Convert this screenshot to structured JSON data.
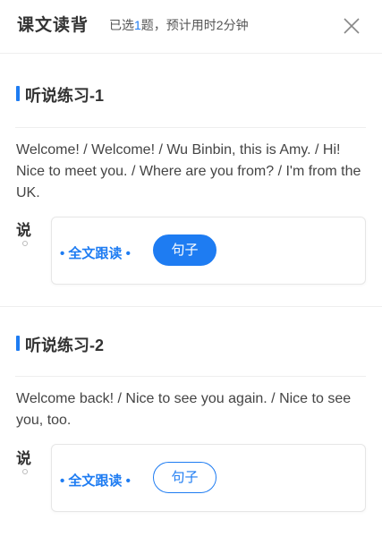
{
  "header": {
    "title": "课文读背",
    "sub_prefix": "已选",
    "sub_count": "1",
    "sub_suffix": "题，预计用时2分钟"
  },
  "sections": [
    {
      "title": "听说练习-1",
      "text": "Welcome! / Welcome! / Wu Binbin, this is Amy. / Hi! Nice to meet you. / Where are you from? / I'm from the UK.",
      "speak_label": "说",
      "follow_label": "• 全文跟读 •",
      "button_label": "句子"
    },
    {
      "title": "听说练习-2",
      "text": "Welcome back! / Nice to see you again. / Nice to see you, too.",
      "speak_label": "说",
      "follow_label": "• 全文跟读 •",
      "button_label": "句子"
    }
  ],
  "icons": {
    "close": "close-icon"
  },
  "colors": {
    "accent": "#1e7cf2"
  }
}
